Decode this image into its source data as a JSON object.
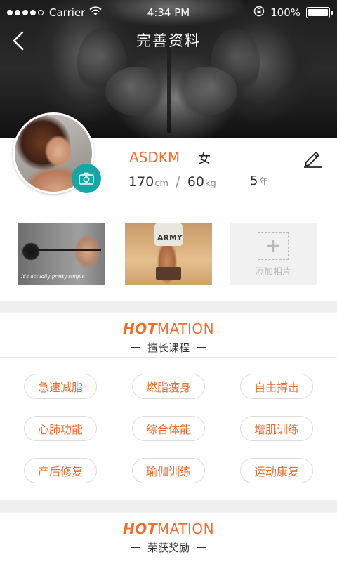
{
  "status_bar": {
    "carrier": "Carrier",
    "time": "4:34 PM",
    "battery": "100%"
  },
  "nav": {
    "title": "完善资料"
  },
  "profile": {
    "name": "ASDKM",
    "gender": "女",
    "height_value": "170",
    "height_unit": "cm",
    "weight_value": "60",
    "weight_unit": "kg",
    "separator": "/",
    "years_value": "5",
    "years_unit": "年"
  },
  "photos": {
    "photo1_caption": "It's actually pretty simple",
    "photo2_shirt_text": "ARMY",
    "add_label": "添加相片"
  },
  "skills_section": {
    "brand_hot": "HOT",
    "brand_mation": "MATION",
    "subtitle": "擅长课程",
    "tags": [
      "急速减脂",
      "燃脂瘦身",
      "自由搏击",
      "心肺功能",
      "综合体能",
      "增肌训练",
      "产后修复",
      "瑜伽训练",
      "运动康复"
    ]
  },
  "awards_section": {
    "brand_hot": "HOT",
    "brand_mation": "MATION",
    "subtitle": "荣获奖励"
  },
  "colors": {
    "accent_orange": "#f06c2c",
    "camera_teal": "#17a6a6",
    "divider": "#e6e6e6",
    "band_gray": "#efefef"
  },
  "icons": [
    "back-arrow-icon",
    "wifi-icon",
    "lock-rotation-icon",
    "battery-icon",
    "camera-icon",
    "pencil-edit-icon",
    "plus-icon"
  ]
}
